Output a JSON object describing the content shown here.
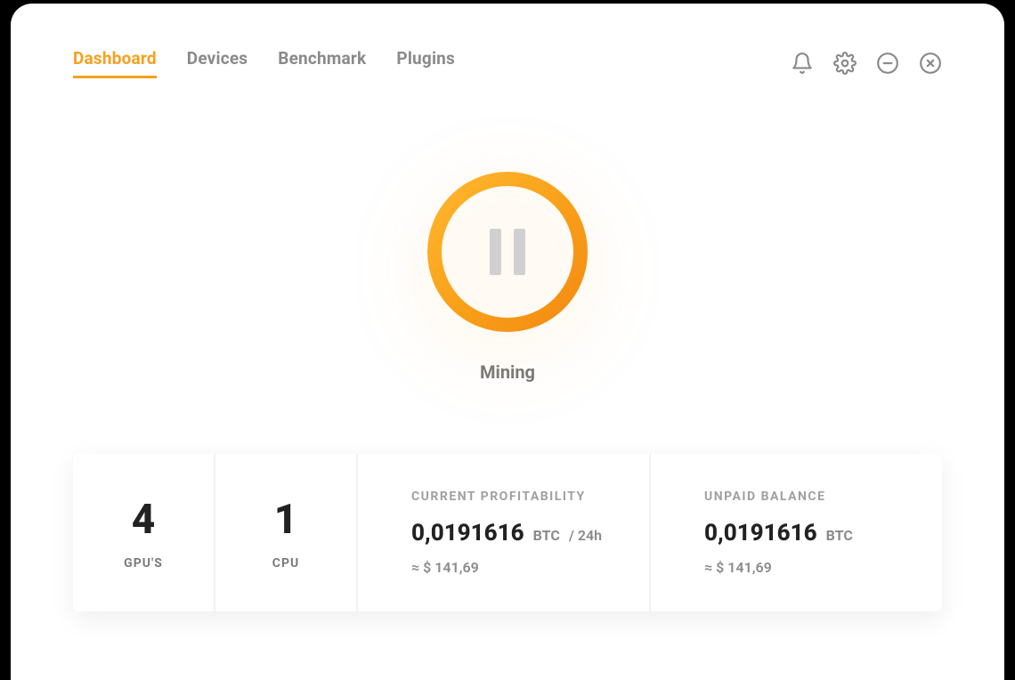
{
  "tabs": {
    "dashboard": "Dashboard",
    "devices": "Devices",
    "benchmark": "Benchmark",
    "plugins": "Plugins"
  },
  "status": {
    "label": "Mining"
  },
  "gpu": {
    "count": "4",
    "label": "GPU'S"
  },
  "cpu": {
    "count": "1",
    "label": "CPU"
  },
  "profitability": {
    "title": "CURRENT PROFITABILITY",
    "value": "0,0191616",
    "unit": "BTC",
    "per": "/ 24h",
    "approx": "≈ $ 141,69"
  },
  "balance": {
    "title": "UNPAID BALANCE",
    "value": "0,0191616",
    "unit": "BTC",
    "approx": "≈ $ 141,69"
  }
}
